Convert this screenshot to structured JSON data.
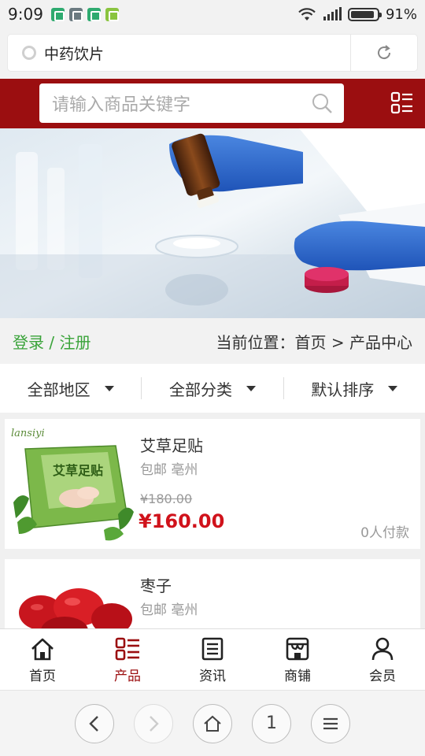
{
  "status_bar": {
    "time": "9:09",
    "battery": "91%",
    "battery_level": 0.91
  },
  "browser": {
    "page_title": "中药饮片",
    "tab_count": "1"
  },
  "header": {
    "search_placeholder": "请输入商品关键字"
  },
  "auth": {
    "login_register": "登录 / 注册"
  },
  "breadcrumb": "当前位置：首页 > 产品中心",
  "filters": [
    {
      "label": "全部地区"
    },
    {
      "label": "全部分类"
    },
    {
      "label": "默认排序"
    }
  ],
  "products": [
    {
      "name": "艾草足贴",
      "shipping": "包邮 亳州",
      "original_price": "¥180.00",
      "price": "¥160.00",
      "payers": "0人付款",
      "brand": "lansiyi",
      "box_text": "艾草足贴"
    },
    {
      "name": "枣子",
      "shipping": "包邮 亳州"
    }
  ],
  "bottom_nav": [
    {
      "label": "首页",
      "icon": "home-icon"
    },
    {
      "label": "产品",
      "icon": "list-icon",
      "active": true
    },
    {
      "label": "资讯",
      "icon": "news-icon"
    },
    {
      "label": "商铺",
      "icon": "shop-icon"
    },
    {
      "label": "会员",
      "icon": "user-icon"
    }
  ],
  "colors": {
    "brand_red": "#9b0e10",
    "price_red": "#d0121b",
    "login_green": "#3aa33a"
  }
}
